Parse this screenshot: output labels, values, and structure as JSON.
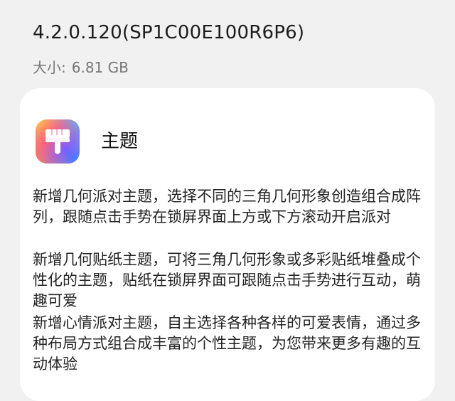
{
  "update": {
    "version": "4.2.0.120(SP1C00E100R6P6)",
    "size_label": "大小:",
    "size_value": "6.81 GB"
  },
  "app": {
    "name": "主题",
    "icon": "paintbrush-icon"
  },
  "features": [
    "新增几何派对主题，选择不同的三角几何形象创造组合成阵列，跟随点击手势在锁屏界面上方或下方滚动开启派对",
    "新增几何贴纸主题，可将三角几何形象或多彩贴纸堆叠成个性化的主题，贴纸在锁屏界面可跟随点击手势进行互动，萌趣可爱",
    "新增心情派对主题，自主选择各种各样的可爱表情，通过多种布局方式组合成丰富的个性主题，为您带来更多有趣的互动体验"
  ],
  "colors": {
    "background": "#f1f1f1",
    "card": "#ffffff",
    "icon_gradient": [
      "#ff4f7a",
      "#ffb340",
      "#7ad96b",
      "#3fb6ff",
      "#8a5cf6"
    ]
  }
}
